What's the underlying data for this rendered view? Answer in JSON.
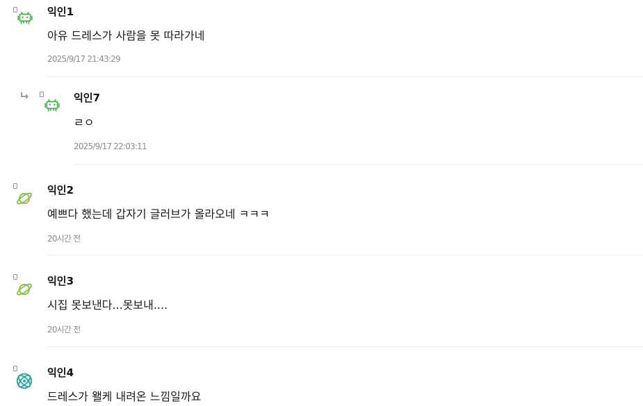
{
  "comments": [
    {
      "author": "익인1",
      "text": "아유 드레스가 사람을 못 따라가네",
      "time": "2025/9/17 21:43:29",
      "avatar": "invader-icon"
    },
    {
      "author": "익인7",
      "text": "ㄹㅇ",
      "time": "2025/9/17 22:03:11",
      "avatar": "invader-icon",
      "reply": true
    },
    {
      "author": "익인2",
      "text": "예쁘다 했는데 갑자기 글러브가 올라오네 ㅋㅋㅋ",
      "time": "20시간 전",
      "avatar": "planet-icon"
    },
    {
      "author": "익인3",
      "text": "시집 못보낸다...못보내....",
      "time": "20시간 전",
      "avatar": "planet-icon"
    },
    {
      "author": "익인4",
      "text": "드레스가 왤케 내려온 느낌일까요",
      "time": "",
      "avatar": "atom-icon"
    }
  ],
  "colors": {
    "invader": "#4caf50",
    "planet": "#8bc34a",
    "atom": "#26a69a"
  }
}
